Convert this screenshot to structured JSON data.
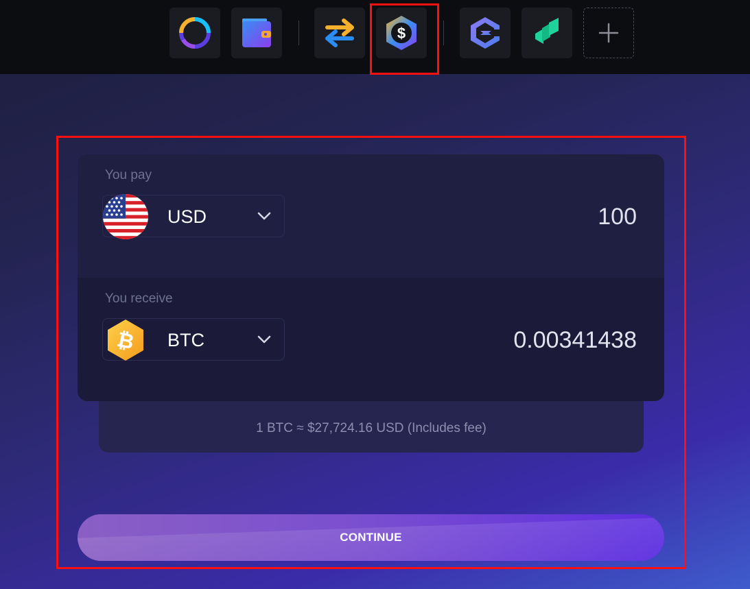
{
  "toolbar": {
    "apps": [
      {
        "icon": "portfolio-ring-icon"
      },
      {
        "icon": "wallet-icon"
      },
      {
        "icon": "exchange-arrows-icon"
      },
      {
        "icon": "buy-crypto-dollar-icon",
        "selected": true
      },
      {
        "icon": "exodus-logo-icon"
      },
      {
        "icon": "compound-logo-icon"
      },
      {
        "icon": "add-app-icon"
      }
    ]
  },
  "pay": {
    "label": "You pay",
    "currency": "USD",
    "currency_icon": "us-flag-icon",
    "amount": "100"
  },
  "receive": {
    "label": "You receive",
    "currency": "BTC",
    "currency_icon": "bitcoin-icon",
    "amount": "0.00341438"
  },
  "rate": {
    "text": "1 BTC ≈ $27,724.16 USD (Includes fee)"
  },
  "continue": {
    "label": "CONTINUE"
  },
  "colors": {
    "highlight": "#ff1010",
    "accent_start": "#8a5fc4",
    "accent_end": "#5c2ee0",
    "bitcoin": "#f7a928"
  }
}
